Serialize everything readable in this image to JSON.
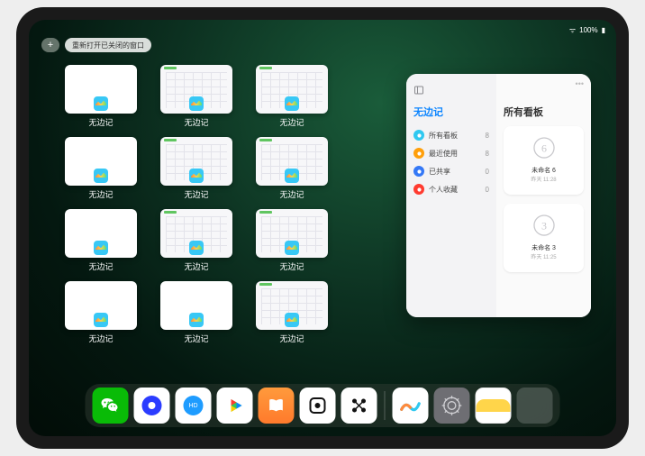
{
  "status": {
    "battery": "100%"
  },
  "topbar": {
    "plus": "+",
    "reopen_label": "重新打开已关闭的窗口"
  },
  "app_name": "无边记",
  "thumbnails": [
    {
      "style": "blank",
      "label": "无边记"
    },
    {
      "style": "calendar",
      "label": "无边记"
    },
    {
      "style": "calendar",
      "label": "无边记"
    },
    null,
    {
      "style": "blank",
      "label": "无边记"
    },
    {
      "style": "calendar",
      "label": "无边记"
    },
    {
      "style": "calendar",
      "label": "无边记"
    },
    null,
    {
      "style": "blank",
      "label": "无边记"
    },
    {
      "style": "calendar",
      "label": "无边记"
    },
    {
      "style": "calendar",
      "label": "无边记"
    },
    null,
    {
      "style": "blank",
      "label": "无边记"
    },
    {
      "style": "blank",
      "label": "无边记"
    },
    {
      "style": "calendar",
      "label": "无边记"
    },
    null
  ],
  "floating": {
    "sidebar_title": "无边记",
    "right_title": "所有看板",
    "items": [
      {
        "label": "所有看板",
        "count": 8,
        "color": "#2fc8f0"
      },
      {
        "label": "最近使用",
        "count": 8,
        "color": "#ff9f0a"
      },
      {
        "label": "已共享",
        "count": 0,
        "color": "#3478f6"
      },
      {
        "label": "个人收藏",
        "count": 0,
        "color": "#ff3b30"
      }
    ],
    "boards": [
      {
        "name": "未命名 6",
        "time": "昨天 11:28",
        "glyph": "6"
      },
      {
        "name": "未命名 3",
        "time": "昨天 11:25",
        "glyph": "3"
      }
    ]
  },
  "dock": {
    "icons": [
      {
        "id": "wechat"
      },
      {
        "id": "q1"
      },
      {
        "id": "q2"
      },
      {
        "id": "play"
      },
      {
        "id": "books"
      },
      {
        "id": "square"
      },
      {
        "id": "dots"
      },
      {
        "id": "sep"
      },
      {
        "id": "freeform"
      },
      {
        "id": "settings"
      },
      {
        "id": "notes"
      },
      {
        "id": "cluster"
      }
    ]
  }
}
